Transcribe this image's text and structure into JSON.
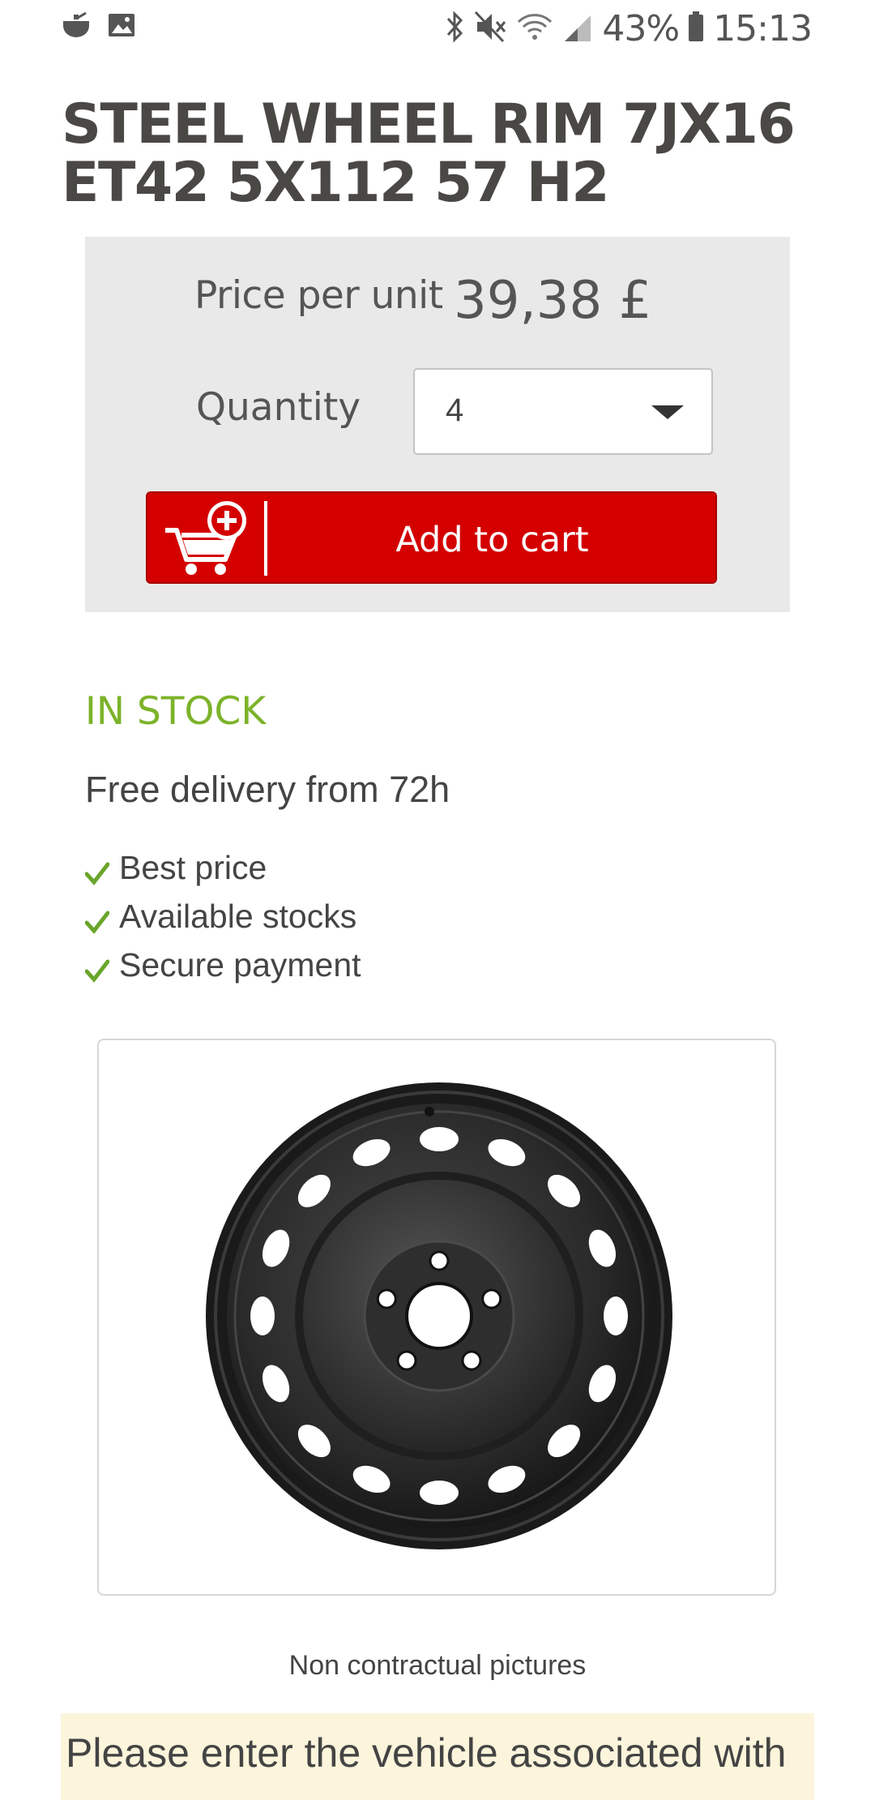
{
  "status_bar": {
    "left_icons": [
      "cooking-pot-icon",
      "image-icon"
    ],
    "right_icons": [
      "bluetooth-icon",
      "mute-icon",
      "wifi-icon",
      "signal-icon",
      "battery-icon"
    ],
    "battery": "43%",
    "time": "15:13"
  },
  "product": {
    "title": "STEEL WHEEL RIM 7JX16 ET42 5X112 57 H2"
  },
  "purchase": {
    "price_label": "Price per unit",
    "price_value": "39,38 £",
    "quantity_label": "Quantity",
    "quantity_value": "4",
    "add_to_cart_label": "Add to cart"
  },
  "stock": {
    "status": "IN STOCK",
    "delivery": "Free delivery from 72h",
    "features": [
      "Best price",
      "Available stocks",
      "Secure payment"
    ]
  },
  "image": {
    "caption": "Non contractual pictures"
  },
  "vehicle_note": {
    "text": "Please enter the vehicle associated with"
  },
  "colors": {
    "accent_red": "#d40000",
    "stock_green": "#7cb32a",
    "panel_grey": "#e9e9e9",
    "note_bg": "#fcf5dc"
  }
}
